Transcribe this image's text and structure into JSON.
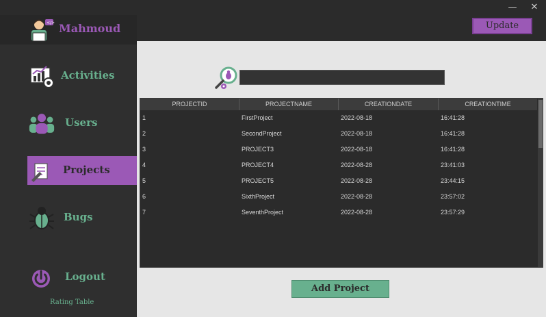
{
  "window": {
    "minimize_glyph": "—",
    "close_glyph": "✕"
  },
  "sidebar": {
    "user_name": "Mahmoud",
    "items": [
      {
        "label": "Activities",
        "icon": "activities-icon"
      },
      {
        "label": "Users",
        "icon": "users-icon"
      },
      {
        "label": "Projects",
        "icon": "projects-icon",
        "active": true
      },
      {
        "label": "Bugs",
        "icon": "bug-icon"
      },
      {
        "label": "Logout",
        "icon": "power-icon"
      }
    ],
    "rating_label": "Rating Table"
  },
  "header": {
    "update_label": "Update"
  },
  "search": {
    "value": "",
    "placeholder": ""
  },
  "table": {
    "columns": [
      "PROJECTID",
      "PROJECTNAME",
      "CREATIONDATE",
      "CREATIONTIME"
    ],
    "rows": [
      [
        "1",
        "FirstProject",
        "2022-08-18",
        "16:41:28"
      ],
      [
        "2",
        "SecondProject",
        "2022-08-18",
        "16:41:28"
      ],
      [
        "3",
        "PROJECT3",
        "2022-08-18",
        "16:41:28"
      ],
      [
        "4",
        "PROJECT4",
        "2022-08-28",
        "23:41:03"
      ],
      [
        "5",
        "PROJECT5",
        "2022-08-28",
        "23:44:15"
      ],
      [
        "6",
        "SixthProject",
        "2022-08-28",
        "23:57:02"
      ],
      [
        "7",
        "SeventhProject",
        "2022-08-28",
        "23:57:29"
      ]
    ]
  },
  "main": {
    "add_label": "Add Project"
  },
  "colors": {
    "accent_purple": "#9b59b6",
    "accent_green": "#68b08e",
    "dark_bg": "#2b2b2b",
    "content_bg": "#e6e6e6"
  }
}
